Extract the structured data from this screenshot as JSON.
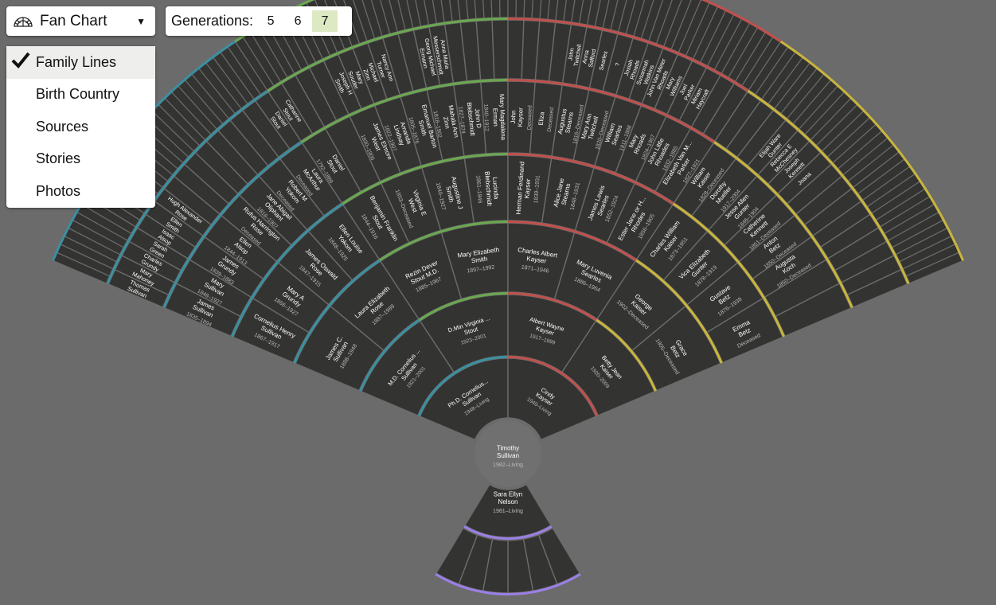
{
  "toolbar": {
    "chart_type_label": "Fan Chart",
    "chart_icon": "fan-chart-icon",
    "caret_icon": "caret-down-icon",
    "generations_label": "Generations:",
    "generation_options": [
      "5",
      "6",
      "7"
    ],
    "selected_generation": "7"
  },
  "menu": {
    "selected": "Family Lines",
    "check_icon": "check-icon",
    "items": [
      "Family Lines",
      "Birth Country",
      "Sources",
      "Stories",
      "Photos"
    ]
  },
  "colors": {
    "background": "#6b6b6b",
    "cell": "#333331",
    "cell_border": "#6b6b6b",
    "center": "#707070",
    "paternal_grandfather_line": "#3a8fa0",
    "paternal_grandmother_line": "#6aa84f",
    "maternal_grandfather_line": "#c0504d",
    "maternal_grandmother_line": "#c9b53a",
    "spouse_line": "#9b7fe6"
  },
  "root": {
    "name": [
      "Timothy",
      "Sullivan"
    ],
    "dates": "1982–Living"
  },
  "spouse": {
    "name": [
      "Sara Ellyn",
      "Nelson"
    ],
    "dates": "1981–Living"
  },
  "generation_1": [
    {
      "name": [
        "Ph.D. Cornelius...",
        "Sullivan"
      ],
      "dates": "1948–Living"
    },
    {
      "name": [
        "Cindy",
        "Kayser"
      ],
      "dates": "1949–Living"
    }
  ],
  "generation_2": [
    {
      "name": [
        "M.D. Cornelius ...",
        "Sullivan"
      ],
      "dates": "1921–2001"
    },
    {
      "name": [
        "D.Min Virginia ...",
        "Stout"
      ],
      "dates": "1923–2001"
    },
    {
      "name": [
        "Albert Wayne",
        "Kayser"
      ],
      "dates": "1917–1999"
    },
    {
      "name": [
        "Betty Jean",
        "Kaiser"
      ],
      "dates": "1920–2009"
    }
  ],
  "generation_3": [
    {
      "name": [
        "James C.",
        "Sullivan"
      ],
      "dates": "1888–1948"
    },
    {
      "name": [
        "Laura Elizabeth",
        "Rose"
      ],
      "dates": "1897–1989"
    },
    {
      "name": [
        "Rezin Dever",
        "Stout M.D."
      ],
      "dates": "1885–1967"
    },
    {
      "name": [
        "Mary Elizabeth",
        "Smith"
      ],
      "dates": "1897–1992"
    },
    {
      "name": [
        "Charles Albert",
        "Kayser"
      ],
      "dates": "1871–1946"
    },
    {
      "name": [
        "Mary Luvenia",
        "Searles"
      ],
      "dates": "1886–1964"
    },
    {
      "name": [
        "George",
        "Kaiser"
      ],
      "dates": "1902–Deceased"
    },
    {
      "name": [
        "Grace",
        "Betz"
      ],
      "dates": "1905–Deceased"
    }
  ],
  "generation_4": [
    {
      "name": [
        "Cornelius Henry",
        "Sullivan"
      ],
      "dates": "1867–1917"
    },
    {
      "name": [
        "Mary A",
        "Grundy"
      ],
      "dates": "1866–1927"
    },
    {
      "name": [
        "James Oswald",
        "Rose"
      ],
      "dates": "1847–1915"
    },
    {
      "name": [
        "Ellen Louise",
        "Yokom"
      ],
      "dates": "1848–1925"
    },
    {
      "name": [
        "Benjamin Franklin",
        "Stout"
      ],
      "dates": "1844–1916"
    },
    {
      "name": [
        "Virginia E",
        "West"
      ],
      "dates": "1853–Deceased"
    },
    {
      "name": [
        "Augustine J",
        "Smith"
      ],
      "dates": "1840–1927"
    },
    {
      "name": [
        "Lucinda",
        "Blebschmidt"
      ],
      "dates": "1861–1946"
    },
    {
      "name": [
        "Herman Ferdinand",
        "Kayser"
      ],
      "dates": "1839–1931"
    },
    {
      "name": [
        "Alice Jane",
        "Stearns"
      ],
      "dates": "1848–1931"
    },
    {
      "name": [
        "James Lewis",
        "Searles"
      ],
      "dates": "1852–1924"
    },
    {
      "name": [
        "Ester Jane or H...",
        "Rhodes"
      ],
      "dates": "1856–1905"
    },
    {
      "name": [
        "Charles William",
        "Kaiser"
      ],
      "dates": "1873–1951"
    },
    {
      "name": [
        "Vica Elizabeth",
        "Gunter"
      ],
      "dates": "1878–1919"
    },
    {
      "name": [
        "Gustave",
        "Betz"
      ],
      "dates": "1876–1938"
    },
    {
      "name": [
        "Emma",
        "Betz"
      ],
      "dates": "Deceased"
    }
  ],
  "generation_5": [
    {
      "name": [
        "James",
        "Sullivan"
      ],
      "dates": "1835–1894"
    },
    {
      "name": [
        "Mary",
        "Sullivan"
      ],
      "dates": "1848–1927"
    },
    {
      "name": [
        "James",
        "Grundy"
      ],
      "dates": "1839–1883"
    },
    {
      "name": [
        "Ellen",
        "Alsop"
      ],
      "dates": "1844–1913"
    },
    {
      "name": [
        "Rufus Harrington",
        "Rose"
      ],
      "dates": "Deceased"
    },
    {
      "name": [
        "Jane Abigail",
        "Oliphant"
      ],
      "dates": "1816–1907"
    },
    {
      "name": [
        "Robert M",
        "Yokom"
      ],
      "dates": "Deceased"
    },
    {
      "name": [
        "Laura",
        "McArthur"
      ],
      "dates": "Deceased"
    },
    {
      "name": [
        "Daniel",
        "Stout"
      ],
      "dates": "1792–1889"
    },
    {
      "name": [
        "",
        ""
      ],
      "dates": ""
    },
    {
      "name": [
        "James Elmore",
        "West"
      ],
      "dates": "1830–1906"
    },
    {
      "name": [
        "Amanda",
        "Lindsay"
      ],
      "dates": "1822–1907"
    },
    {
      "name": [
        "Emanuel Barton",
        "Smith"
      ],
      "dates": "1805–1876"
    },
    {
      "name": [
        "Mahala Ann",
        "Zinn"
      ],
      "dates": "1818–1902"
    },
    {
      "name": [
        "John D",
        "Blebschmidt"
      ],
      "dates": "1827–1874"
    },
    {
      "name": [
        "Mary Magdalena",
        "Erman"
      ],
      "dates": "1840–1912"
    },
    {
      "name": [
        "John",
        "Kayser"
      ],
      "dates": "Deceased"
    },
    {
      "name": [
        "Eliza",
        ""
      ],
      "dates": "Deceased"
    },
    {
      "name": [
        "Augustus",
        "Stearns"
      ],
      "dates": "1816–Deceased"
    },
    {
      "name": [
        "Mary Ann",
        "Twitchell"
      ],
      "dates": "1820–Deceased"
    },
    {
      "name": [
        "William",
        "Searles"
      ],
      "dates": "1811–1888"
    },
    {
      "name": [
        "Mary",
        "Rhoads"
      ],
      "dates": "1824–1907"
    },
    {
      "name": [
        "John Little",
        "Rhoades"
      ],
      "dates": "1832–1885"
    },
    {
      "name": [
        "Elizabeth Van M...",
        "Parker"
      ],
      "dates": "1827–1921"
    },
    {
      "name": [
        "William",
        "Kaiser"
      ],
      "dates": "1828–Deceased"
    },
    {
      "name": [
        "Dorothy",
        "Mueller"
      ],
      "dates": "1917–2004"
    },
    {
      "name": [
        "Jesse Allen",
        "Gunter"
      ],
      "dates": "1846–1904"
    },
    {
      "name": [
        "Catherine",
        "Kennett"
      ],
      "dates": "1851–Deceased"
    },
    {
      "name": [
        "Anton",
        "Betz"
      ],
      "dates": "1850–Deceased"
    },
    {
      "name": [
        "Augusta",
        "Koch"
      ],
      "dates": "1850–Deceased"
    },
    {
      "name": [
        "",
        ""
      ],
      "dates": ""
    },
    {
      "name": [
        "",
        ""
      ],
      "dates": ""
    }
  ],
  "generation_6": [
    {
      "name": [
        "Thomas",
        "Sullivan"
      ]
    },
    {
      "name": [
        "Mary",
        "Mahoney"
      ]
    },
    {
      "name": [
        "Charles",
        "Grundy"
      ]
    },
    {
      "name": [
        "Sarah",
        "Green"
      ]
    },
    {
      "name": [
        "Isaac",
        "Alsop"
      ]
    },
    {
      "name": [
        "Ellen",
        "Smith"
      ]
    },
    {
      "name": [
        "Hugh Alexander",
        "Rose"
      ]
    },
    {
      "name": [
        "",
        ""
      ]
    },
    {
      "name": [
        "",
        ""
      ]
    },
    {
      "name": [
        "",
        ""
      ]
    },
    {
      "name": [
        "",
        ""
      ]
    },
    {
      "name": [
        "",
        ""
      ]
    },
    {
      "name": [
        "",
        ""
      ]
    },
    {
      "name": [
        "",
        ""
      ]
    },
    {
      "name": [
        "",
        ""
      ]
    },
    {
      "name": [
        "Daniel",
        "Stout"
      ]
    },
    {
      "name": [
        "Catharine",
        "Stout"
      ]
    },
    {
      "name": [
        "",
        ""
      ]
    },
    {
      "name": [
        "",
        ""
      ]
    },
    {
      "name": [
        "",
        ""
      ]
    },
    {
      "name": [
        "Joseph H",
        "Smith"
      ]
    },
    {
      "name": [
        "Mary",
        "Souder"
      ]
    },
    {
      "name": [
        "Michael",
        "Zinn"
      ]
    },
    {
      "name": [
        "Nancy Ann",
        "Turner"
      ]
    },
    {
      "name": [
        "",
        ""
      ]
    },
    {
      "name": [
        "",
        ""
      ]
    },
    {
      "name": [
        "Georg Michael",
        "Ermann"
      ]
    },
    {
      "name": [
        "Anna Maria",
        "Messerschmidt"
      ]
    },
    {
      "name": [
        "",
        ""
      ]
    },
    {
      "name": [
        "",
        ""
      ]
    },
    {
      "name": [
        "",
        ""
      ]
    },
    {
      "name": [
        "",
        ""
      ]
    },
    {
      "name": [
        "",
        ""
      ]
    },
    {
      "name": [
        "",
        ""
      ]
    },
    {
      "name": [
        "",
        ""
      ]
    },
    {
      "name": [
        "",
        ""
      ]
    },
    {
      "name": [
        "John",
        "Twitchell"
      ]
    },
    {
      "name": [
        "Anna",
        "Safford"
      ]
    },
    {
      "name": [
        "Searles",
        ""
      ]
    },
    {
      "name": [
        "?",
        ""
      ]
    },
    {
      "name": [
        "Josiah",
        "Rhoads"
      ]
    },
    {
      "name": [
        "Susannah",
        "Watkins"
      ]
    },
    {
      "name": [
        "John Van Meter",
        "Rhoads"
      ]
    },
    {
      "name": [
        "Mary",
        "Williams"
      ]
    },
    {
      "name": [
        "Joel",
        "Parker"
      ]
    },
    {
      "name": [
        "Miriam",
        "Haycraft"
      ]
    },
    {
      "name": [
        "",
        ""
      ]
    },
    {
      "name": [
        "",
        ""
      ]
    },
    {
      "name": [
        "",
        ""
      ]
    },
    {
      "name": [
        "",
        ""
      ]
    },
    {
      "name": [
        "",
        ""
      ]
    },
    {
      "name": [
        "Elijah Ware",
        "Gunter"
      ]
    },
    {
      "name": [
        "Rebecca E",
        "McChesney"
      ]
    },
    {
      "name": [
        "Joseph",
        "Kennett"
      ]
    },
    {
      "name": [
        "Joana",
        ""
      ]
    },
    {
      "name": [
        "",
        ""
      ]
    },
    {
      "name": [
        "",
        ""
      ]
    },
    {
      "name": [
        "",
        ""
      ]
    },
    {
      "name": [
        "",
        ""
      ]
    },
    {
      "name": [
        "",
        ""
      ]
    },
    {
      "name": [
        "",
        ""
      ]
    },
    {
      "name": [
        "",
        ""
      ]
    },
    {
      "name": [
        "",
        ""
      ]
    },
    {
      "name": [
        "",
        ""
      ]
    }
  ]
}
